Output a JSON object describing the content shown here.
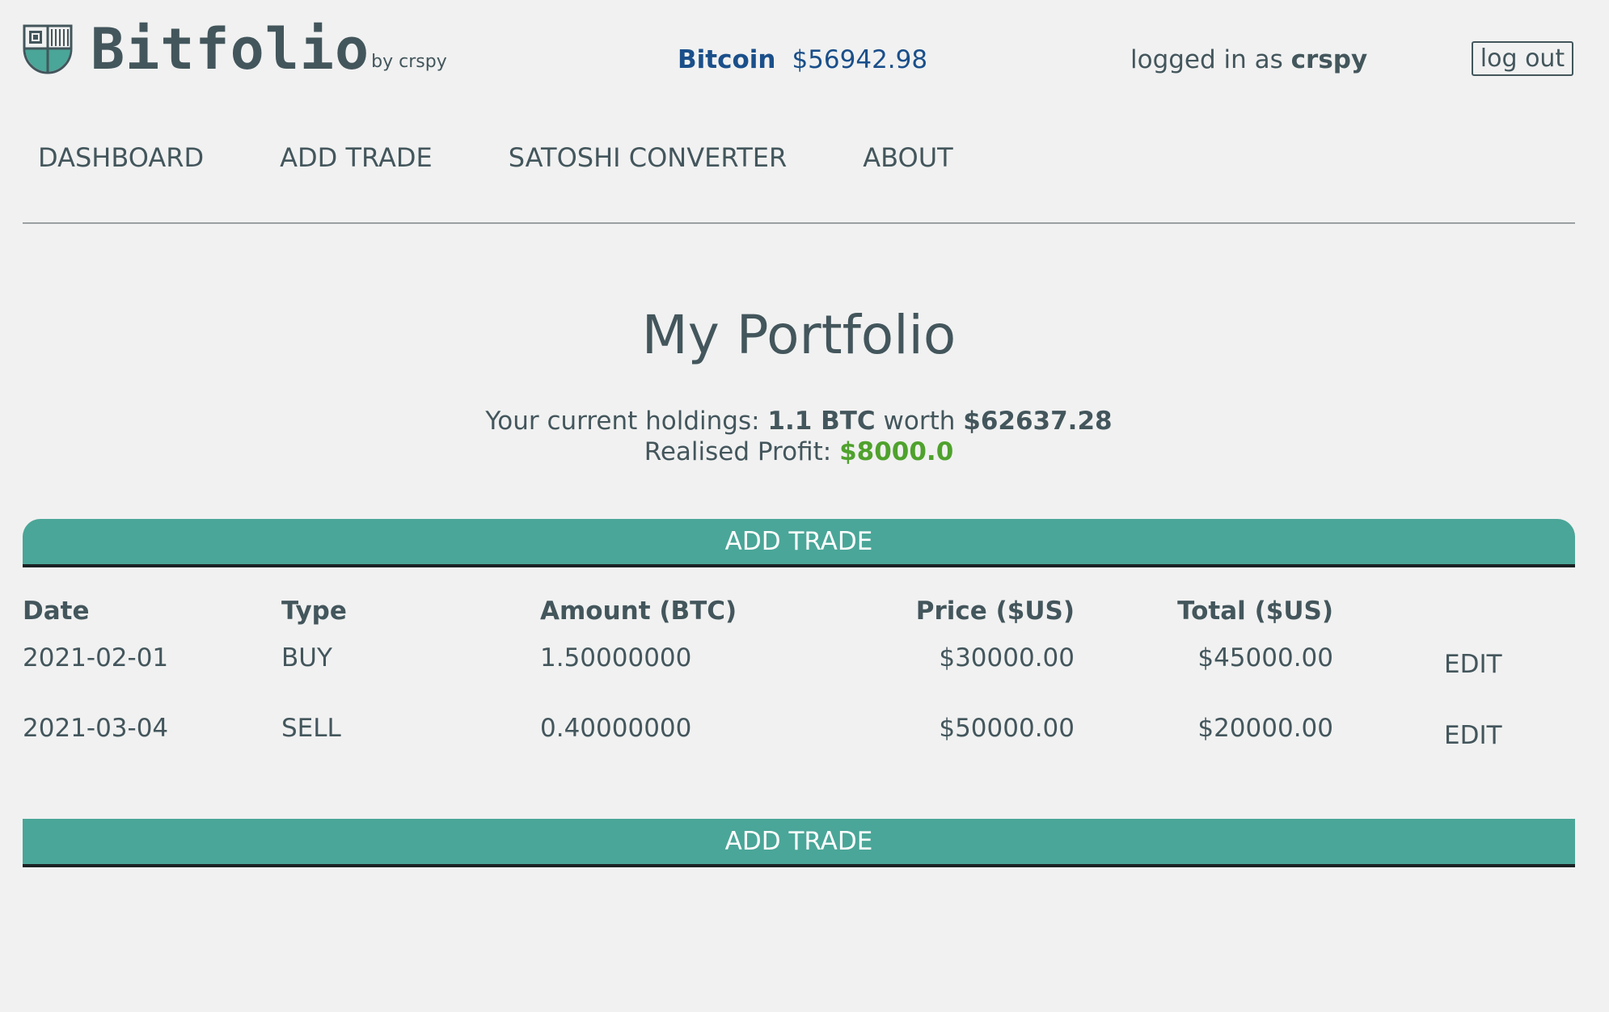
{
  "brand": {
    "name": "Bitfolio",
    "by": "by crspy"
  },
  "ticker": {
    "coin": "Bitcoin",
    "price": "$56942.98"
  },
  "auth": {
    "prefix": "logged in as",
    "username": "crspy",
    "logout_label": "log out"
  },
  "nav": {
    "items": [
      "DASHBOARD",
      "ADD TRADE",
      "SATOSHI CONVERTER",
      "ABOUT"
    ]
  },
  "portfolio": {
    "title": "My Portfolio",
    "holdings_prefix": "Your current holdings:",
    "holdings_amount": "1.1 BTC",
    "holdings_worth_word": "worth",
    "holdings_value": "$62637.28",
    "profit_label": "Realised Profit:",
    "profit_value": "$8000.0"
  },
  "actions": {
    "add_trade_top": "ADD TRADE",
    "add_trade_bottom": "ADD TRADE"
  },
  "table": {
    "headers": [
      "Date",
      "Type",
      "Amount (BTC)",
      "Price ($US)",
      "Total ($US)"
    ],
    "rows": [
      {
        "date": "2021-02-01",
        "type": "BUY",
        "amount": "1.50000000",
        "price": "$30000.00",
        "total": "$45000.00",
        "action": "EDIT"
      },
      {
        "date": "2021-03-04",
        "type": "SELL",
        "amount": "0.40000000",
        "price": "$50000.00",
        "total": "$20000.00",
        "action": "EDIT"
      }
    ]
  },
  "colors": {
    "background": "#f1f1f1",
    "text": "#43565c",
    "accent_teal": "#4aa698",
    "price_blue": "#1a4f8a",
    "profit_green": "#4fa22d"
  },
  "icons": {
    "logo": "shield-chip-icon"
  }
}
